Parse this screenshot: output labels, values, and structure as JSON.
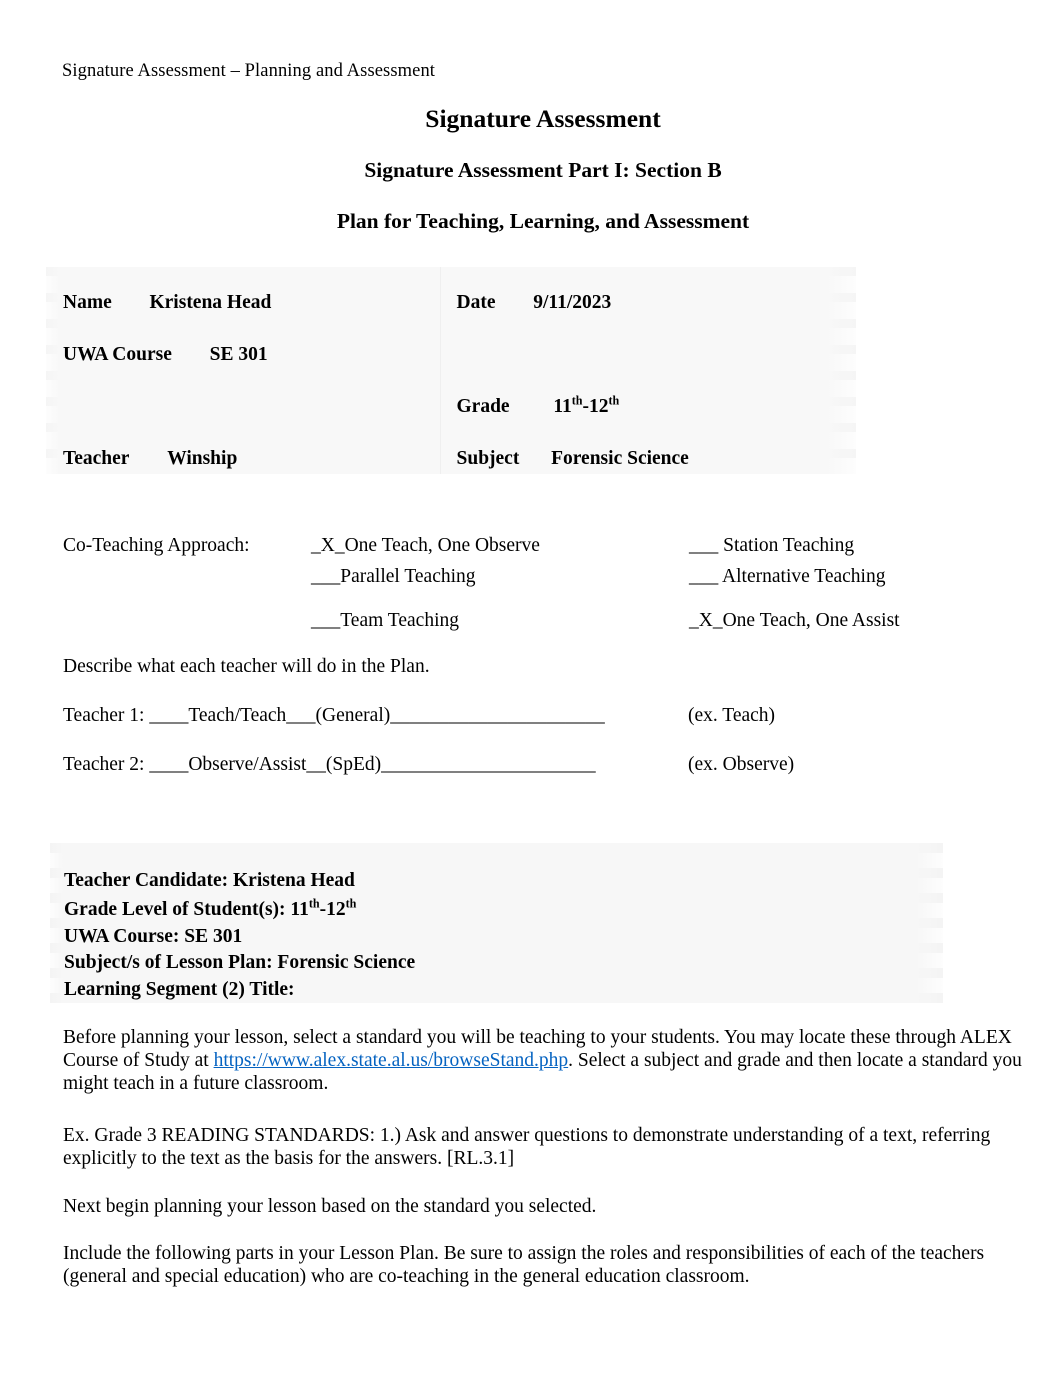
{
  "document": {
    "running_header": "Signature Assessment – Planning and Assessment",
    "title_main": "Signature Assessment",
    "title_sub1": "Signature Assessment Part I: Section B",
    "title_sub2": "Plan for Teaching, Learning, and Assessment"
  },
  "info_table": {
    "rows": [
      {
        "left_label": "Name",
        "left_value": "Kristena Head",
        "right_label": "Date",
        "right_value": "9/11/2023"
      },
      {
        "left_label": "UWA Course",
        "left_value": "SE 301",
        "right_label": "",
        "right_value": ""
      },
      {
        "left_label": "",
        "left_value": "",
        "right_label": "Grade",
        "right_value_base1": "11",
        "right_value_sup1": "th",
        "right_value_sep": "-12",
        "right_value_sup2": "th"
      },
      {
        "left_label": "Teacher",
        "left_value": "Winship",
        "right_label": "Subject",
        "right_value": "Forensic Science"
      }
    ]
  },
  "coteaching": {
    "label": "Co-Teaching Approach:",
    "option_1": "_X_One Teach, One Observe",
    "option_2": "___Parallel Teaching",
    "option_3": "___ Station Teaching",
    "option_4": "___ Alternative Teaching",
    "option_5": "___Team Teaching",
    "option_6": "_X_One Teach, One Assist"
  },
  "describe": {
    "prompt": "Describe what each teacher will do in the Plan.",
    "teacher1_line": "Teacher 1: ____Teach/Teach___(General)______________________",
    "teacher1_example": "(ex. Teach)",
    "teacher2_line": "Teacher 2: ____Observe/Assist__(SpEd)______________________",
    "teacher2_example": "(ex. Observe)"
  },
  "candidate_box": {
    "teacher_candidate": "Teacher Candidate:  Kristena Head",
    "grade_level_label": "Grade Level of Student(s):  ",
    "grade_level_base1": "11",
    "grade_level_sup1": "th",
    "grade_level_sep": "-12",
    "grade_level_sup2": "th",
    "uwa_course": "UWA Course:  SE 301",
    "subject": "Subject/s of Lesson Plan: Forensic Science",
    "learning_segment": "Learning Segment (2) Title:"
  },
  "body": {
    "para1_part1": "Before planning your lesson, select a standard you will be teaching to your students.  You may locate these through ALEX Course of Study at ",
    "para1_link": "https://www.alex.state.al.us/browseStand.php",
    "para1_part2": ".  Select a subject and grade and then locate a standard you might teach in a future classroom.",
    "para2": "Ex. Grade 3 READING STANDARDS:  1.) Ask and answer questions to demonstrate understanding of a text, referring explicitly to the text as the basis for the answers. [RL.3.1]",
    "para3": "Next begin planning your lesson based on the standard you selected.",
    "para4": "Include the following parts in your Lesson Plan.  Be sure to assign the roles and responsibilities of each of the teachers (general and special education) who are co-teaching in the general education classroom."
  },
  "colors": {
    "link": "#0563C1",
    "text": "#000000",
    "table_shade": "#f5f5f5"
  }
}
